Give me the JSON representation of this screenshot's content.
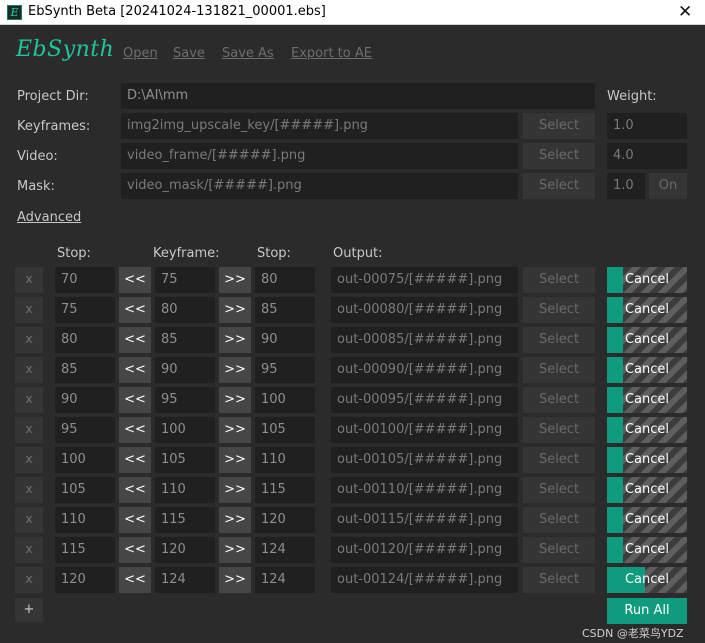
{
  "window": {
    "title": "EbSynth Beta [20241024-131821_00001.ebs]",
    "close_glyph": "✕"
  },
  "logo": "EbSynth",
  "menu": {
    "open": "Open",
    "save": "Save",
    "save_as": "Save As",
    "export": "Export to AE"
  },
  "project": {
    "project_dir_label": "Project Dir:",
    "project_dir": "D:\\AI\\mm",
    "keyframes_label": "Keyframes:",
    "keyframes": "img2img_upscale_key/[#####].png",
    "video_label": "Video:",
    "video": "video_frame/[#####].png",
    "mask_label": "Mask:",
    "mask": "video_mask/[#####].png",
    "select_label": "Select",
    "weight_label": "Weight:",
    "keyframes_weight": "1.0",
    "video_weight": "4.0",
    "mask_weight": "1.0",
    "mask_toggle": "On"
  },
  "advanced_link": "Advanced",
  "table": {
    "headers": {
      "stop_left": "Stop:",
      "keyframe": "Keyframe:",
      "stop_right": "Stop:",
      "output": "Output:"
    },
    "remove_glyph": "x",
    "prev_glyph": "<<",
    "next_glyph": ">>",
    "select_label": "Select",
    "cancel_label": "Cancel",
    "rows": [
      {
        "stop_left": "70",
        "keyframe": "75",
        "stop_right": "80",
        "output": "out-00075/[#####].png",
        "progress": 0.2
      },
      {
        "stop_left": "75",
        "keyframe": "80",
        "stop_right": "85",
        "output": "out-00080/[#####].png",
        "progress": 0.2
      },
      {
        "stop_left": "80",
        "keyframe": "85",
        "stop_right": "90",
        "output": "out-00085/[#####].png",
        "progress": 0.2
      },
      {
        "stop_left": "85",
        "keyframe": "90",
        "stop_right": "95",
        "output": "out-00090/[#####].png",
        "progress": 0.2
      },
      {
        "stop_left": "90",
        "keyframe": "95",
        "stop_right": "100",
        "output": "out-00095/[#####].png",
        "progress": 0.2
      },
      {
        "stop_left": "95",
        "keyframe": "100",
        "stop_right": "105",
        "output": "out-00100/[#####].png",
        "progress": 0.2
      },
      {
        "stop_left": "100",
        "keyframe": "105",
        "stop_right": "110",
        "output": "out-00105/[#####].png",
        "progress": 0.2
      },
      {
        "stop_left": "105",
        "keyframe": "110",
        "stop_right": "115",
        "output": "out-00110/[#####].png",
        "progress": 0.2
      },
      {
        "stop_left": "110",
        "keyframe": "115",
        "stop_right": "120",
        "output": "out-00115/[#####].png",
        "progress": 0.2
      },
      {
        "stop_left": "115",
        "keyframe": "120",
        "stop_right": "124",
        "output": "out-00120/[#####].png",
        "progress": 0.2
      },
      {
        "stop_left": "120",
        "keyframe": "124",
        "stop_right": "124",
        "output": "out-00124/[#####].png",
        "progress": 0.47
      }
    ]
  },
  "add_row_glyph": "+",
  "run_all_label": "Run All",
  "watermark": "CSDN @老菜鸟YDZ",
  "colors": {
    "accent": "#0f9b7d",
    "logo": "#1fc49b",
    "background": "#2b2b2b",
    "field": "#202020"
  }
}
